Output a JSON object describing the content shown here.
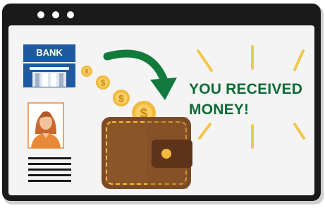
{
  "bank": {
    "label": "BANK"
  },
  "message": {
    "line1": "YOU RECEIVED",
    "line2": "MONEY!"
  },
  "icons": [
    "window-dots-icon",
    "bank-icon",
    "user-profile-icon",
    "coin-icon",
    "curved-arrow-icon",
    "wallet-icon",
    "burst-rays-icon"
  ],
  "colors": {
    "window_frame": "#1a1a1a",
    "window_bg": "#f4f4f4",
    "bank_blue": "#1f5aa0",
    "arrow_green": "#117a3c",
    "message_green": "#0e6b34",
    "coin_gold": "#f3b93c",
    "wallet_brown": "#7b4a24",
    "ray_yellow": "#f2c84b",
    "profile_orange": "#e8893a"
  }
}
